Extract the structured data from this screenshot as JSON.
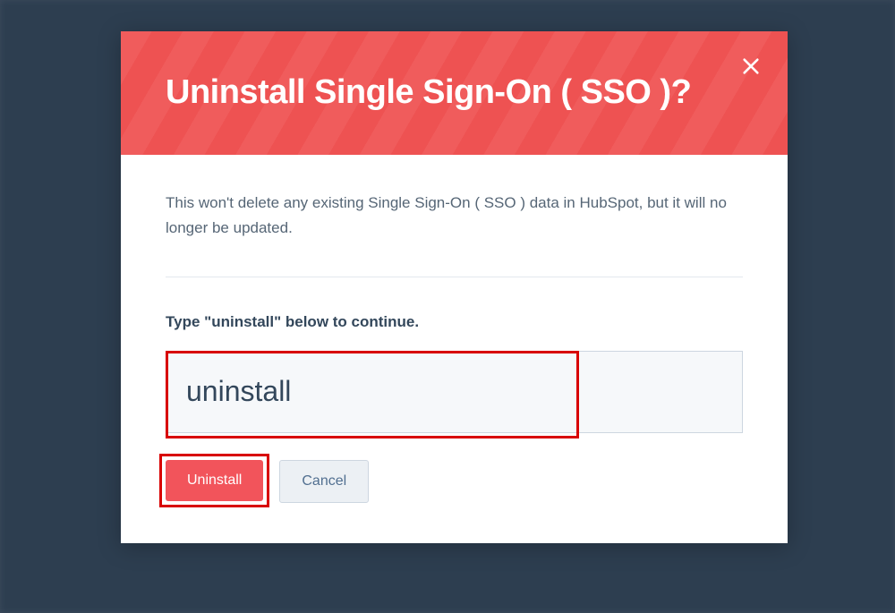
{
  "modal": {
    "title": "Uninstall Single Sign-On ( SSO )?",
    "description": "This won't delete any existing Single Sign-On ( SSO ) data in HubSpot, but it will no longer be updated.",
    "prompt": "Type \"uninstall\" below to continue.",
    "input_value": "uninstall",
    "uninstall_label": "Uninstall",
    "cancel_label": "Cancel"
  },
  "colors": {
    "danger": "#f05c5c",
    "danger_btn": "#f2545b",
    "highlight": "#d80000",
    "text_primary": "#33475b",
    "text_secondary": "#566676"
  }
}
